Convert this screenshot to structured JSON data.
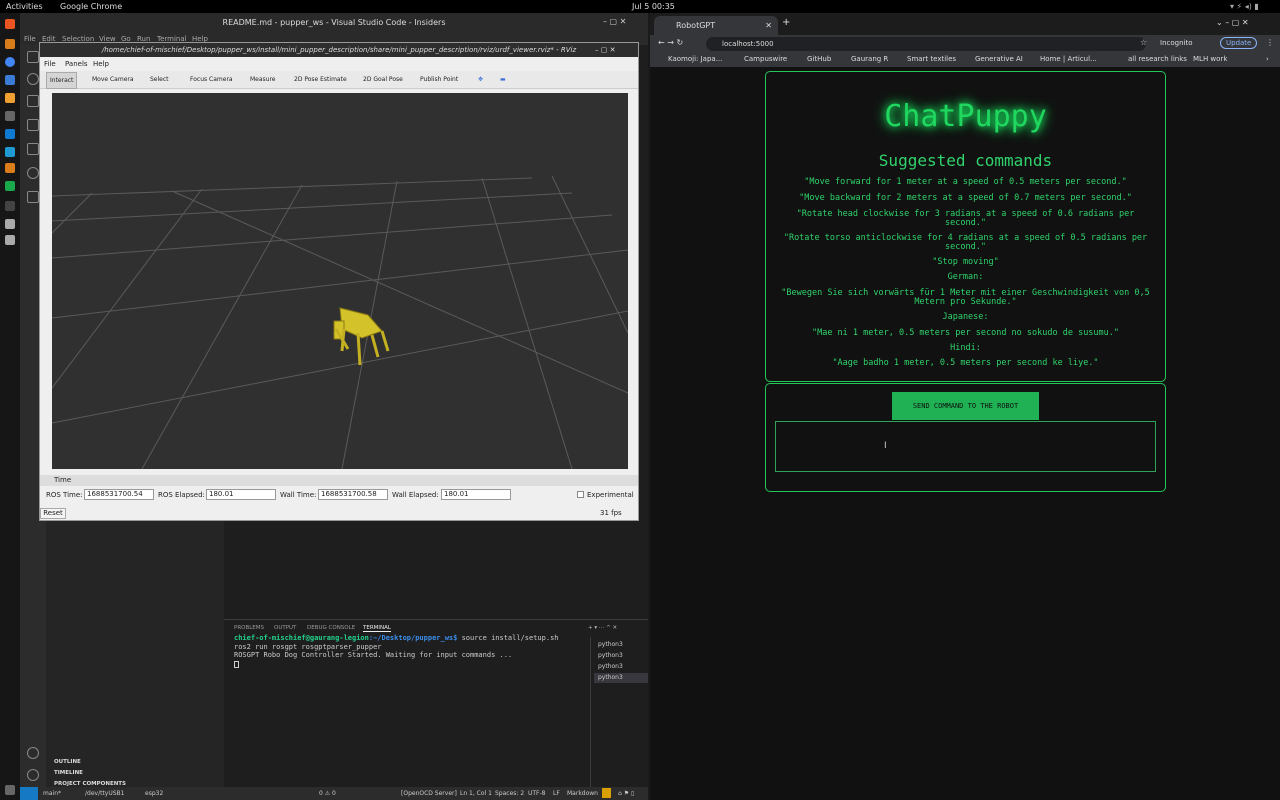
{
  "topbar": {
    "activities": "Activities",
    "app": "Google Chrome",
    "datetime": "Jul 5  00:35"
  },
  "vscode": {
    "title": "README.md - pupper_ws - Visual Studio Code - Insiders",
    "menu": [
      "File",
      "Edit",
      "Selection",
      "View",
      "Go",
      "Run",
      "Terminal",
      "Help"
    ],
    "sidebar_sections": [
      "OUTLINE",
      "TIMELINE",
      "PROJECT COMPONENTS"
    ],
    "panel_tabs": [
      "PROBLEMS",
      "OUTPUT",
      "DEBUG CONSOLE",
      "TERMINAL"
    ],
    "terminal": {
      "prompt_user": "chief-of-mischief@gaurang-legion",
      "prompt_path": ":~/Desktop/pupper_ws$ ",
      "prompt_cmd": "source install/setup.sh",
      "line2": "ros2 run rosgpt rosgptparser_pupper",
      "line3": "ROSGPT Robo Dog Controller Started. Waiting for input commands ..."
    },
    "terminal_list": [
      "python3",
      "python3",
      "python3",
      "python3"
    ],
    "status": {
      "branch": "main*",
      "port": "/dev/ttyUSB1",
      "board": "esp32",
      "errors": "0 ⚠ 0",
      "server": "[OpenOCD Server]",
      "pos": "Ln 1, Col 1",
      "spaces": "Spaces: 2",
      "enc": "UTF-8",
      "eol": "LF",
      "lang": "Markdown"
    }
  },
  "rviz": {
    "title": "/home/chief-of-mischief/Desktop/pupper_ws/install/mini_pupper_description/share/mini_pupper_description/rviz/urdf_viewer.rviz* - RViz",
    "menu": [
      "File",
      "Panels",
      "Help"
    ],
    "tools": [
      "Interact",
      "Move Camera",
      "Select",
      "Focus Camera",
      "Measure",
      "2D Pose Estimate",
      "2D Goal Pose",
      "Publish Point"
    ],
    "time_header": "Time",
    "ros_time_label": "ROS Time:",
    "ros_time": "1688531700.54",
    "ros_elapsed_label": "ROS Elapsed:",
    "ros_elapsed": "180.01",
    "wall_time_label": "Wall Time:",
    "wall_time": "1688531700.58",
    "wall_elapsed_label": "Wall Elapsed:",
    "wall_elapsed": "180.01",
    "experimental": "Experimental",
    "reset": "Reset",
    "fps": "31 fps"
  },
  "chrome": {
    "tab_title": "RobotGPT",
    "url": "localhost:5000",
    "incognito": "Incognito",
    "update": "Update",
    "bookmarks": [
      "Kaomoji: Japa...",
      "Campuswire",
      "GitHub",
      "Gaurang R",
      "Smart textiles",
      "Generative AI",
      "Home | Articul...",
      "all research links",
      "MLH work"
    ]
  },
  "app": {
    "logo": "ChatPuppy",
    "heading": "Suggested commands",
    "commands": [
      "\"Move forward for 1 meter at a speed of 0.5 meters per second.\"",
      "\"Move backward for 2 meters at a speed of 0.7 meters per second.\"",
      "\"Rotate head clockwise for 3 radians at a speed of 0.6 radians per second.\"",
      "\"Rotate torso anticlockwise for 4 radians at a speed of 0.5 radians per second.\"",
      "\"Stop moving\"",
      "German:",
      "\"Bewegen Sie sich vorwärts für 1 Meter mit einer Geschwindigkeit von 0,5 Metern pro Sekunde.\"",
      "Japanese:",
      "\"Mae ni 1 meter, 0.5 meters per second no sokudo de susumu.\"",
      "Hindi:",
      "\"Aage badho 1 meter, 0.5 meters per second ke liye.\""
    ],
    "send_button": "SEND COMMAND TO THE ROBOT",
    "input_value": ""
  }
}
